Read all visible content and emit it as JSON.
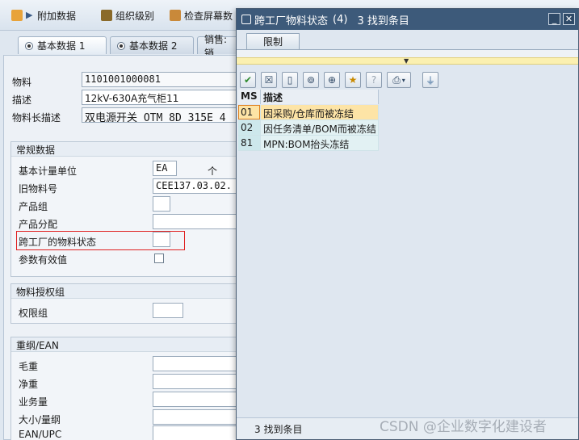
{
  "toolbar": {
    "additional_data": "附加数据",
    "org_levels": "组织级别",
    "check_screen": "检查屏幕数"
  },
  "tabs": [
    {
      "label": "基本数据 1"
    },
    {
      "label": "基本数据 2"
    },
    {
      "label": "销售: 销"
    }
  ],
  "header": {
    "material_label": "物料",
    "material_value": "1101001000081",
    "desc_label": "描述",
    "desc_value": "12kV-630A充气柜11",
    "longdesc_label": "物料长描述",
    "longdesc_value": "双电源开关 OTM 8D 315E 4"
  },
  "general": {
    "title": "常规数据",
    "base_uom_label": "基本计量单位",
    "base_uom_value": "EA",
    "base_uom_text": "个",
    "old_mat_label": "旧物料号",
    "old_mat_value": "CEE137.03.02.",
    "product_group_label": "产品组",
    "product_alloc_label": "产品分配",
    "xplant_status_label": "跨工厂的物料状态",
    "param_valid_label": "参数有效值"
  },
  "auth": {
    "title": "物料授权组",
    "auth_group_label": "权限组"
  },
  "weights": {
    "title": "重纲/EAN",
    "gross_label": "毛重",
    "net_label": "净重",
    "volume_label": "业务量",
    "size_label": "大小/量纲",
    "ean_label": "EAN/UPC"
  },
  "dialog": {
    "title": "跨工厂物料状态",
    "count": "(4)",
    "found_title": "3 找到条目",
    "restrict_tab": "限制",
    "col_ms": "MS",
    "col_desc": "描述",
    "rows": [
      {
        "code": "01",
        "desc": "因采购/仓库而被冻结"
      },
      {
        "code": "02",
        "desc": "因任务清单/BOM而被冻结"
      },
      {
        "code": "81",
        "desc": "MPN:BOM抬头冻结"
      }
    ],
    "status": "3 找到条目"
  },
  "watermark": "CSDN @企业数字化建设者"
}
